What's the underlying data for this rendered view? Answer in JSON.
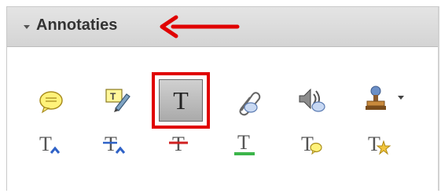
{
  "panel": {
    "title": "Annotaties",
    "collapse_icon": "triangle-down-icon",
    "callout_icon": "red-arrow-icon"
  },
  "toolbar_row1": [
    {
      "name": "sticky-note-icon"
    },
    {
      "name": "text-edit-pencil-icon"
    },
    {
      "name": "add-text-box-icon",
      "glyph": "T",
      "selected": true
    },
    {
      "name": "attach-file-paperclip-icon"
    },
    {
      "name": "record-audio-icon"
    },
    {
      "name": "stamp-icon"
    }
  ],
  "toolbar_row2": [
    {
      "name": "insert-text-icon"
    },
    {
      "name": "replace-text-icon"
    },
    {
      "name": "strikethrough-text-icon"
    },
    {
      "name": "underline-text-icon"
    },
    {
      "name": "text-comment-icon"
    },
    {
      "name": "text-callout-star-icon"
    }
  ],
  "colors": {
    "highlight_border": "#e00000",
    "arrow": "#e00000",
    "header_bg": "#d8d8d8"
  }
}
